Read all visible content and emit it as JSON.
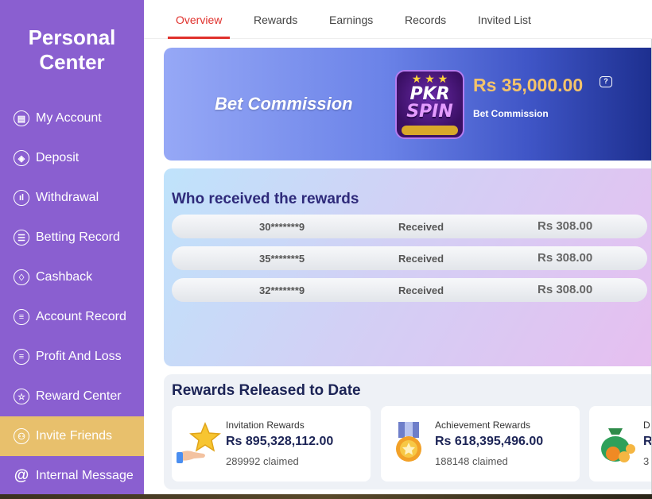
{
  "sidebar": {
    "title_line1": "Personal",
    "title_line2": "Center",
    "items": [
      {
        "label": "My Account",
        "icon": "wallet-icon",
        "glyph": "▤",
        "active": false
      },
      {
        "label": "Deposit",
        "icon": "deposit-icon",
        "glyph": "◈",
        "active": false
      },
      {
        "label": "Withdrawal",
        "icon": "withdrawal-icon",
        "glyph": "ıl",
        "active": false
      },
      {
        "label": "Betting Record",
        "icon": "clipboard-icon",
        "glyph": "☰",
        "active": false
      },
      {
        "label": "Cashback",
        "icon": "cashback-icon",
        "glyph": "♢",
        "active": false
      },
      {
        "label": "Account Record",
        "icon": "record-icon",
        "glyph": "≡",
        "active": false
      },
      {
        "label": "Profit And Loss",
        "icon": "profit-icon",
        "glyph": "≡",
        "active": false
      },
      {
        "label": "Reward Center",
        "icon": "star-icon",
        "glyph": "☆",
        "active": false
      },
      {
        "label": "Invite Friends",
        "icon": "invite-friends-icon",
        "glyph": "⚇",
        "active": true
      },
      {
        "label": "Internal Message",
        "icon": "at-icon",
        "glyph": "@",
        "active": false
      }
    ]
  },
  "tabs": [
    "Overview",
    "Rewards",
    "Earnings",
    "Records",
    "Invited List"
  ],
  "active_tab": "Overview",
  "commission": {
    "title": "Bet Commission",
    "logo_line1": "PKR",
    "logo_line2": "SPIN",
    "amount": "Rs  35,000.00",
    "caption": "Bet Commission"
  },
  "received": {
    "title": "Who received the rewards",
    "rows": [
      {
        "uid": "30*******9",
        "status": "Received",
        "amount": "Rs  308.00"
      },
      {
        "uid": "35*******5",
        "status": "Received",
        "amount": "Rs  308.00"
      },
      {
        "uid": "32*******9",
        "status": "Received",
        "amount": "Rs  308.00"
      }
    ]
  },
  "released": {
    "title": "Rewards Released to Date",
    "cards": [
      {
        "name": "Invitation Rewards",
        "amount": "Rs  895,328,112.00",
        "claimed": "289992 claimed",
        "icon": "hand-star-icon"
      },
      {
        "name": "Achievement Rewards",
        "amount": "Rs  618,395,496.00",
        "claimed": "188148 claimed",
        "icon": "medal-icon"
      },
      {
        "name": "D",
        "amount": "R",
        "claimed": "3",
        "icon": "money-bag-icon"
      }
    ]
  },
  "colors": {
    "sidebar": "#8a5fd0",
    "sidebar_active": "#e8c06c",
    "tab_active": "#e0312c",
    "amount": "#f3c36b"
  }
}
